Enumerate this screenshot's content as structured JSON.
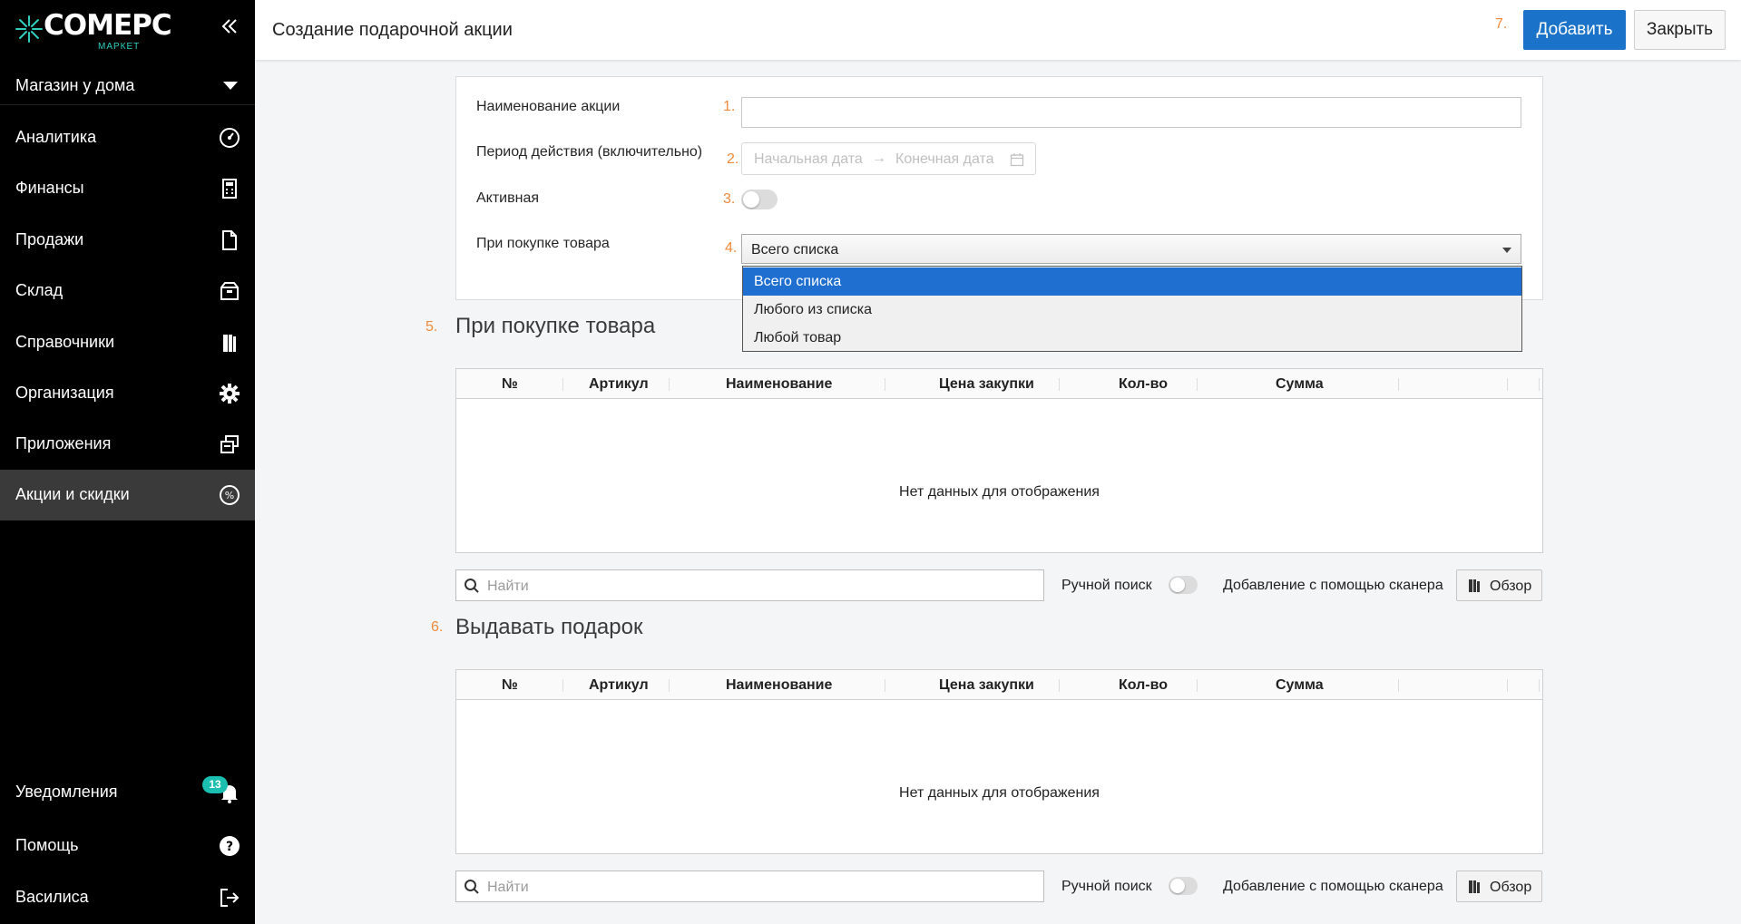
{
  "brand": {
    "name": "COMEPC",
    "sub": "МАРКЕТ",
    "accent": "#2fcfc0"
  },
  "sidebar": {
    "store": "Магазин у дома",
    "items": [
      {
        "label": "Аналитика",
        "icon": "gauge-icon"
      },
      {
        "label": "Финансы",
        "icon": "calculator-icon"
      },
      {
        "label": "Продажи",
        "icon": "document-icon"
      },
      {
        "label": "Склад",
        "icon": "box-icon"
      },
      {
        "label": "Справочники",
        "icon": "books-icon"
      },
      {
        "label": "Организация",
        "icon": "gear-icon"
      },
      {
        "label": "Приложения",
        "icon": "windows-icon"
      },
      {
        "label": "Акции и скидки",
        "icon": "percent-icon",
        "active": true
      }
    ],
    "notifications": {
      "label": "Уведомления",
      "count": "13"
    },
    "help": "Помощь",
    "user": "Василиса"
  },
  "header": {
    "title": "Создание подарочной акции",
    "add_label": "Добавить",
    "close_label": "Закрыть",
    "primary_color": "#1a73c8"
  },
  "markers": {
    "m1": "1.",
    "m2": "2.",
    "m3": "3.",
    "m4": "4.",
    "m5": "5.",
    "m6": "6.",
    "m7": "7."
  },
  "form": {
    "name_label": "Наименование акции",
    "name_value": "",
    "period_label": "Период действия (включительно)",
    "start_placeholder": "Начальная дата",
    "end_placeholder": "Конечная дата",
    "active_label": "Активная",
    "active": false,
    "purchase_label": "При покупке товара",
    "purchase_value": "Всего списка",
    "purchase_options": [
      "Всего списка",
      "Любого из списка",
      "Любой товар"
    ]
  },
  "sections": [
    {
      "title": "При покупке товара",
      "columns": [
        "№",
        "Артикул",
        "Наименование",
        "Цена закупки",
        "Кол-во",
        "Сумма"
      ],
      "empty_text": "Нет данных для отображения",
      "search_placeholder": "Найти",
      "manual_search_label": "Ручной поиск",
      "scanner_label": "Добавление с помощью сканера",
      "browse_label": "Обзор"
    },
    {
      "title": "Выдавать подарок",
      "columns": [
        "№",
        "Артикул",
        "Наименование",
        "Цена закупки",
        "Кол-во",
        "Сумма"
      ],
      "empty_text": "Нет данных для отображения",
      "search_placeholder": "Найти",
      "manual_search_label": "Ручной поиск",
      "scanner_label": "Добавление с помощью сканера",
      "browse_label": "Обзор"
    }
  ]
}
